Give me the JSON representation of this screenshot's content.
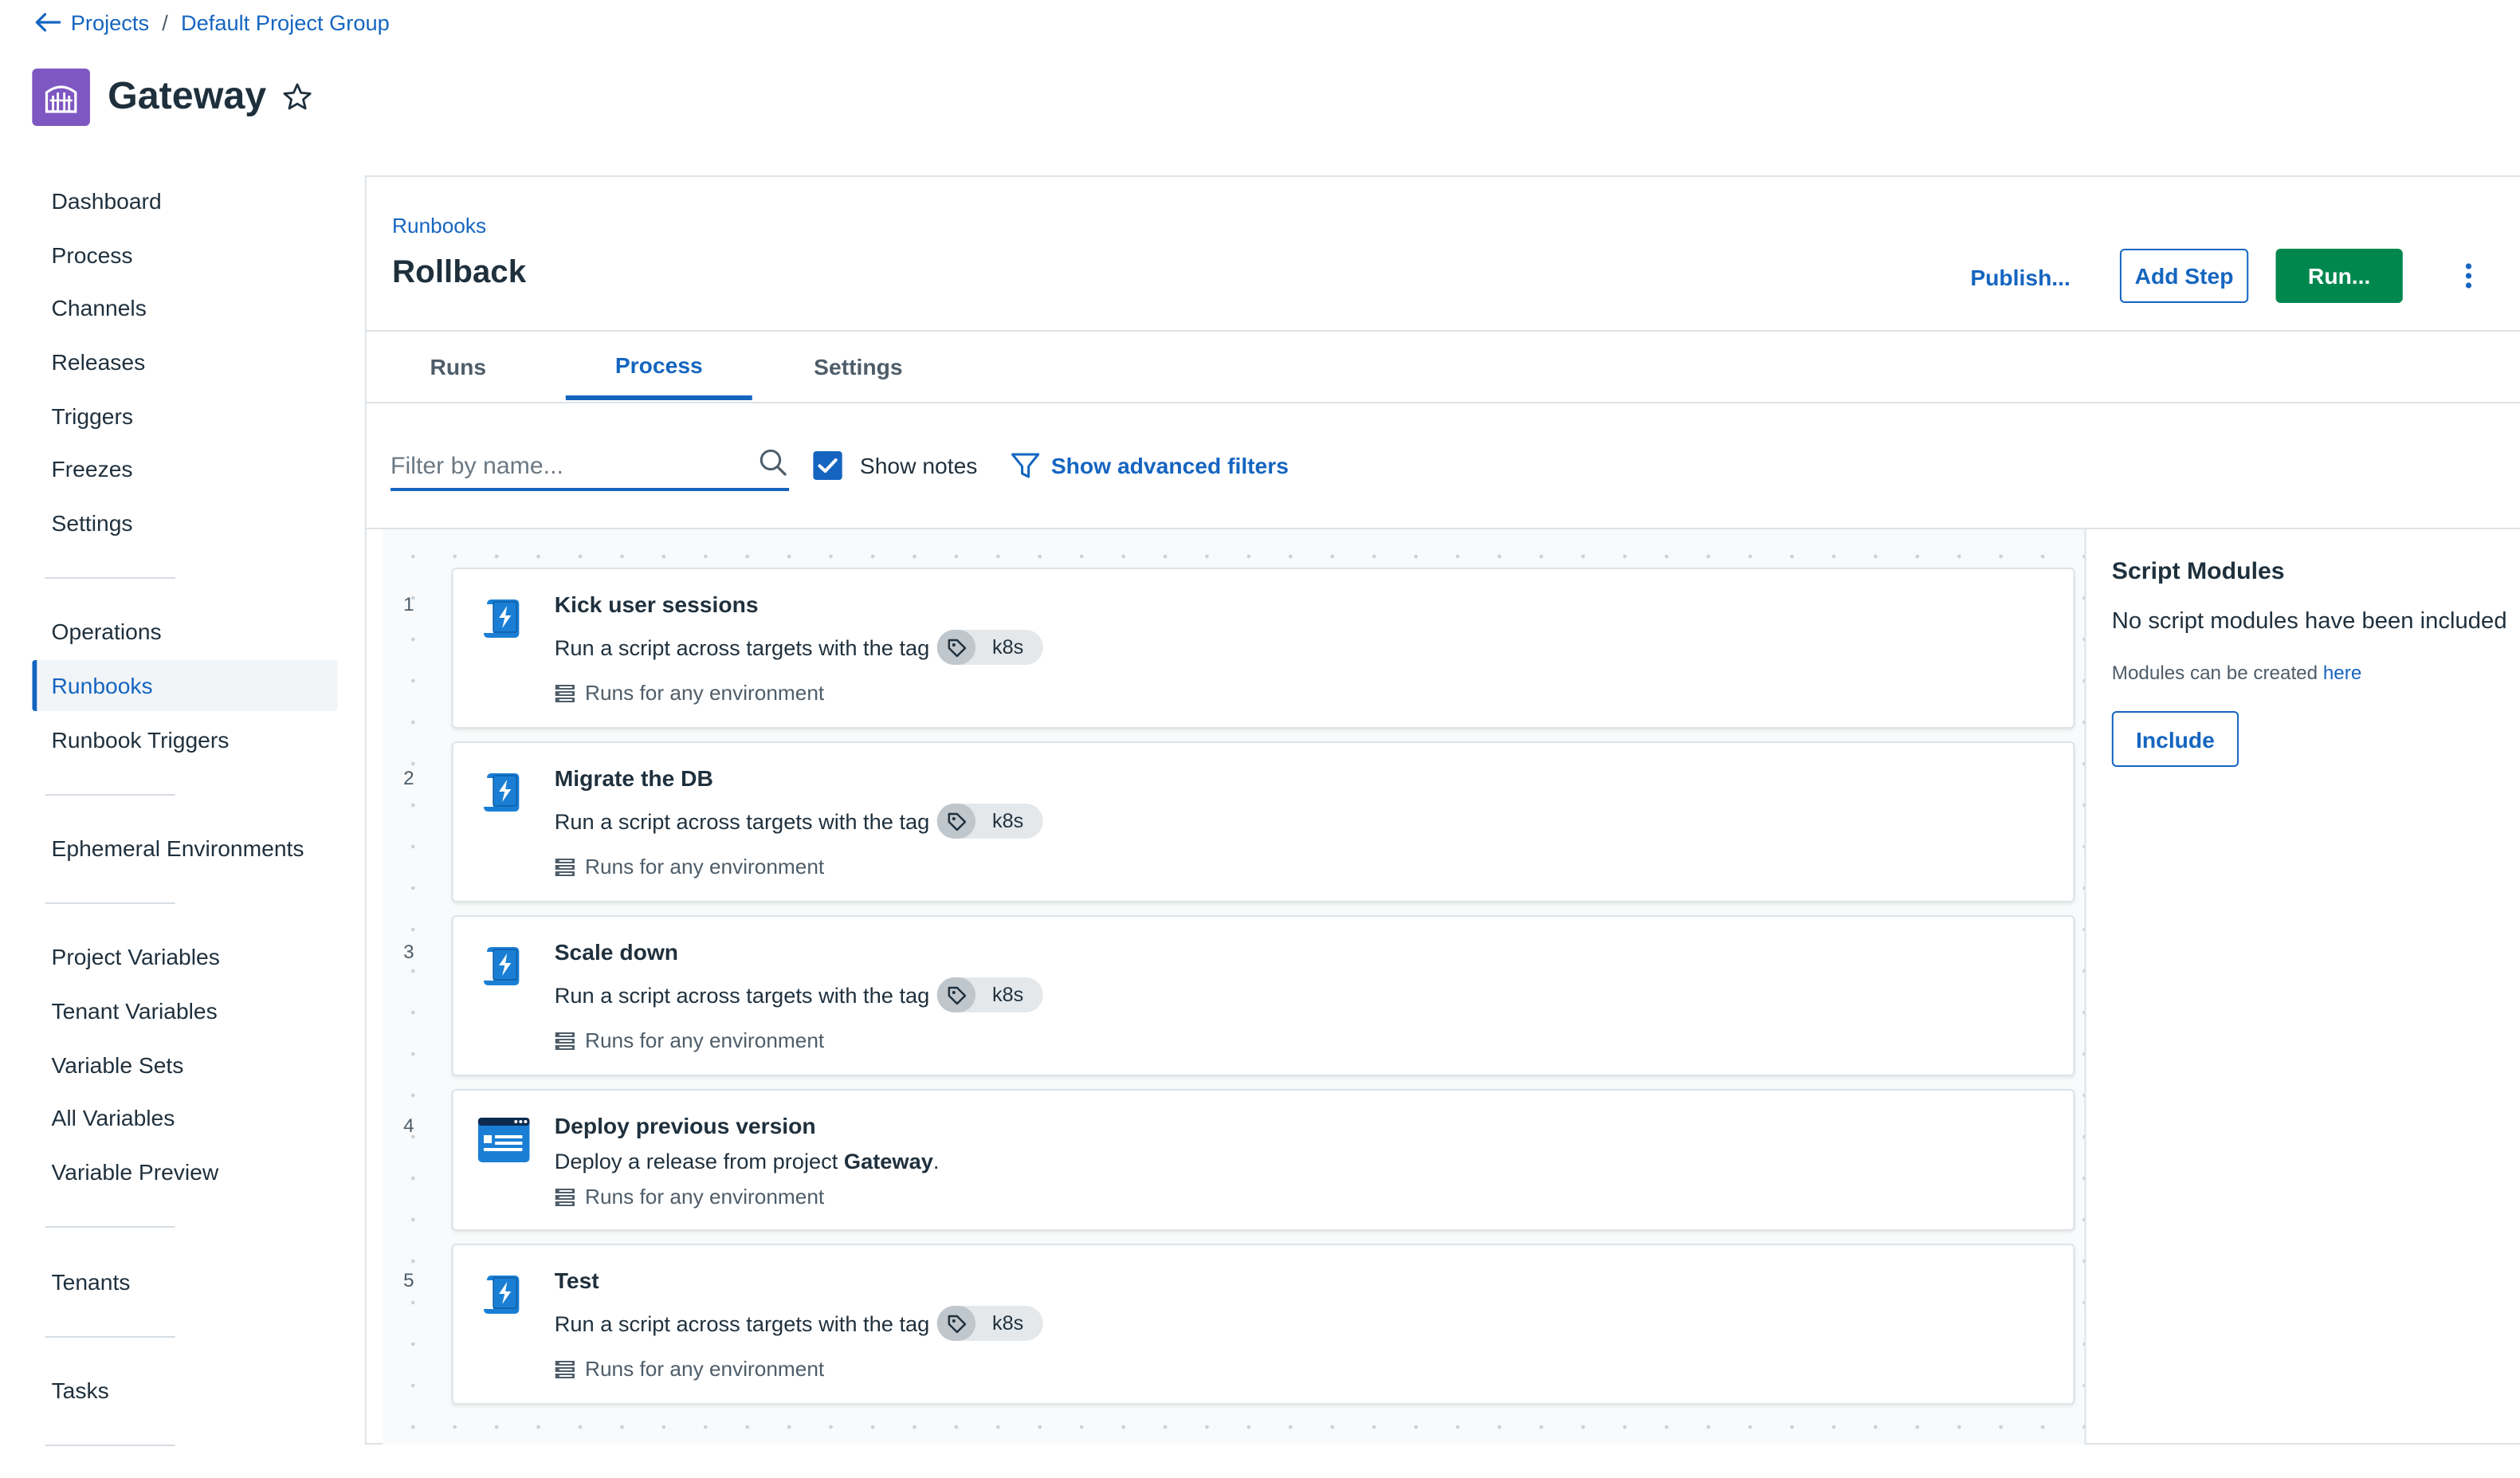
{
  "breadcrumb": {
    "projects": "Projects",
    "separator": "/",
    "group": "Default Project Group"
  },
  "project": {
    "title": "Gateway"
  },
  "sidebar": {
    "items": [
      {
        "label": "Dashboard",
        "active": false
      },
      {
        "label": "Process",
        "active": false
      },
      {
        "label": "Channels",
        "active": false
      },
      {
        "label": "Releases",
        "active": false
      },
      {
        "label": "Triggers",
        "active": false
      },
      {
        "label": "Freezes",
        "active": false
      },
      {
        "label": "Settings",
        "active": false
      },
      {
        "label": "Operations",
        "active": false
      },
      {
        "label": "Runbooks",
        "active": true
      },
      {
        "label": "Runbook Triggers",
        "active": false
      },
      {
        "label": "Ephemeral Environments",
        "active": false
      },
      {
        "label": "Project Variables",
        "active": false
      },
      {
        "label": "Tenant Variables",
        "active": false
      },
      {
        "label": "Variable Sets",
        "active": false
      },
      {
        "label": "All Variables",
        "active": false
      },
      {
        "label": "Variable Preview",
        "active": false
      },
      {
        "label": "Tenants",
        "active": false
      },
      {
        "label": "Tasks",
        "active": false
      }
    ]
  },
  "runbook": {
    "breadcrumb": "Runbooks",
    "title": "Rollback",
    "actions": {
      "publish": "Publish...",
      "add_step": "Add Step",
      "run": "Run..."
    }
  },
  "tabs": [
    {
      "label": "Runs",
      "active": false
    },
    {
      "label": "Process",
      "active": true
    },
    {
      "label": "Settings",
      "active": false
    }
  ],
  "filters": {
    "search_placeholder": "Filter by name...",
    "show_notes_label": "Show notes",
    "show_notes_checked": true,
    "advanced_label": "Show advanced filters"
  },
  "steps": [
    {
      "number": "1",
      "name": "Kick user sessions",
      "description": "Run a script across targets with the tag",
      "tag": "k8s",
      "environment": "Runs for any environment",
      "icon": "script-icon"
    },
    {
      "number": "2",
      "name": "Migrate the DB",
      "description": "Run a script across targets with the tag",
      "tag": "k8s",
      "environment": "Runs for any environment",
      "icon": "script-icon"
    },
    {
      "number": "3",
      "name": "Scale down",
      "description": "Run a script across targets with the tag",
      "tag": "k8s",
      "environment": "Runs for any environment",
      "icon": "script-icon"
    },
    {
      "number": "4",
      "name": "Deploy previous version",
      "description_prefix": "Deploy a release from project ",
      "description_project": "Gateway",
      "description_suffix": ".",
      "environment": "Runs for any environment",
      "icon": "deploy-release-icon"
    },
    {
      "number": "5",
      "name": "Test",
      "description": "Run a script across targets with the tag",
      "tag": "k8s",
      "environment": "Runs for any environment",
      "icon": "script-icon"
    }
  ],
  "script_modules": {
    "title": "Script Modules",
    "empty_text": "No script modules have been included",
    "hint": "Modules can be created ",
    "hint_link": "here",
    "include_label": "Include"
  },
  "colors": {
    "accent": "#1565c0",
    "run_button": "#00874d",
    "project_logo": "#7e57c2",
    "step_icon": "#1a7fd4"
  }
}
